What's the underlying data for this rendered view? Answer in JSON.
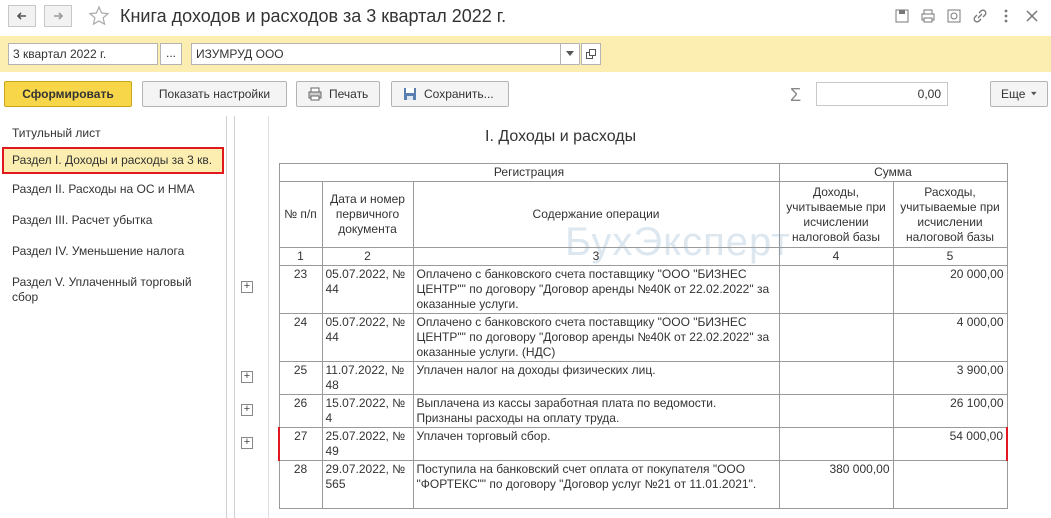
{
  "window": {
    "title": "Книга доходов и расходов за 3 квартал 2022 г."
  },
  "params": {
    "period": "3 квартал 2022 г.",
    "period_button": "...",
    "organization": "ИЗУМРУД ООО"
  },
  "toolbar": {
    "generate": "Сформировать",
    "show_settings": "Показать настройки",
    "print": "Печать",
    "save": "Сохранить...",
    "sum_value": "0,00",
    "more": "Еще"
  },
  "sidebar": {
    "items": [
      {
        "label": "Титульный лист"
      },
      {
        "label": "Раздел I. Доходы и расходы за 3 кв."
      },
      {
        "label": "Раздел II. Расходы на ОС и НМА"
      },
      {
        "label": "Раздел III. Расчет убытка"
      },
      {
        "label": "Раздел IV. Уменьшение налога"
      },
      {
        "label": "Раздел V. Уплаченный торговый сбор"
      }
    ]
  },
  "report": {
    "title": "I. Доходы и расходы",
    "watermark": "БухЭксперт",
    "headers": {
      "registration": "Регистрация",
      "sum": "Сумма",
      "num": "№ п/п",
      "date": "Дата и номер первичного документа",
      "content": "Содержание операции",
      "income": "Доходы, учитываемые при исчислении налоговой базы",
      "expense": "Расходы, учитываемые при исчислении налоговой базы"
    },
    "col_numbers": [
      "1",
      "2",
      "3",
      "4",
      "5"
    ],
    "rows": [
      {
        "n": "23",
        "date": "05.07.2022, № 44",
        "content": "Оплачено с банковского счета поставщику \"ООО \"БИЗНЕС ЦЕНТР\"\" по договору \"Договор аренды №40К от 22.02.2022\" за оказанные услуги.",
        "income": "",
        "expense": "20 000,00"
      },
      {
        "n": "24",
        "date": "05.07.2022, № 44",
        "content": "Оплачено с банковского счета поставщику \"ООО \"БИЗНЕС ЦЕНТР\"\" по договору \"Договор аренды №40К от 22.02.2022\" за оказанные услуги. (НДС)",
        "income": "",
        "expense": "4 000,00"
      },
      {
        "n": "25",
        "date": "11.07.2022, № 48",
        "content": "Уплачен налог на доходы физических лиц.",
        "income": "",
        "expense": "3 900,00"
      },
      {
        "n": "26",
        "date": "15.07.2022, № 4",
        "content": "Выплачена из кассы заработная плата по ведомости. Признаны расходы на оплату труда.",
        "income": "",
        "expense": "26 100,00"
      },
      {
        "n": "27",
        "date": "25.07.2022, № 49",
        "content": "Уплачен торговый сбор.",
        "income": "",
        "expense": "54 000,00"
      },
      {
        "n": "28",
        "date": "29.07.2022, № 565",
        "content": "Поступила на банковский счет оплата от покупателя \"ООО \"ФОРТЕКС\"\" по договору \"Договор услуг №21 от 11.01.2021\".",
        "income": "380 000,00",
        "expense": ""
      }
    ]
  }
}
